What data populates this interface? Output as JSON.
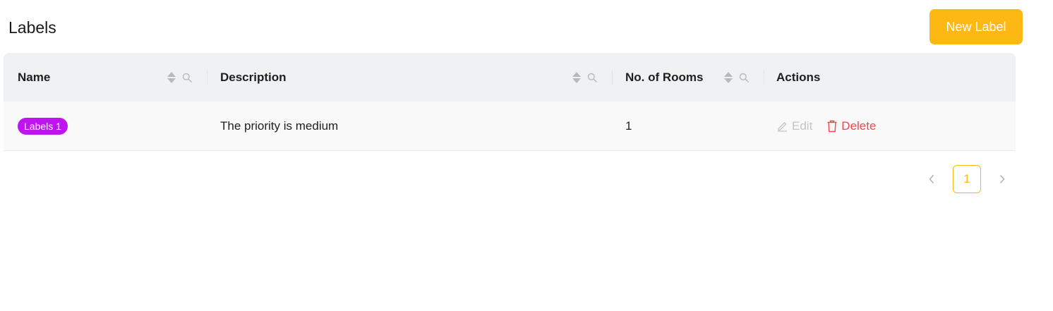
{
  "header": {
    "title": "Labels",
    "new_label_button": "New Label"
  },
  "table": {
    "columns": [
      {
        "label": "Name",
        "sortable": true,
        "filterable": true
      },
      {
        "label": "Description",
        "sortable": true,
        "filterable": true
      },
      {
        "label": "No. of Rooms",
        "sortable": true,
        "filterable": true
      },
      {
        "label": "Actions",
        "sortable": false,
        "filterable": false
      }
    ],
    "rows": [
      {
        "name": "Labels 1",
        "tag_color": "#C013F2",
        "description": "The priority is medium",
        "rooms": "1",
        "actions": {
          "edit": "Edit",
          "delete": "Delete"
        }
      }
    ]
  },
  "pagination": {
    "current_page": "1",
    "accent": "#FDB813"
  },
  "colors": {
    "primary": "#FDB813",
    "delete": "#f0474b",
    "tag": "#C013F2"
  }
}
